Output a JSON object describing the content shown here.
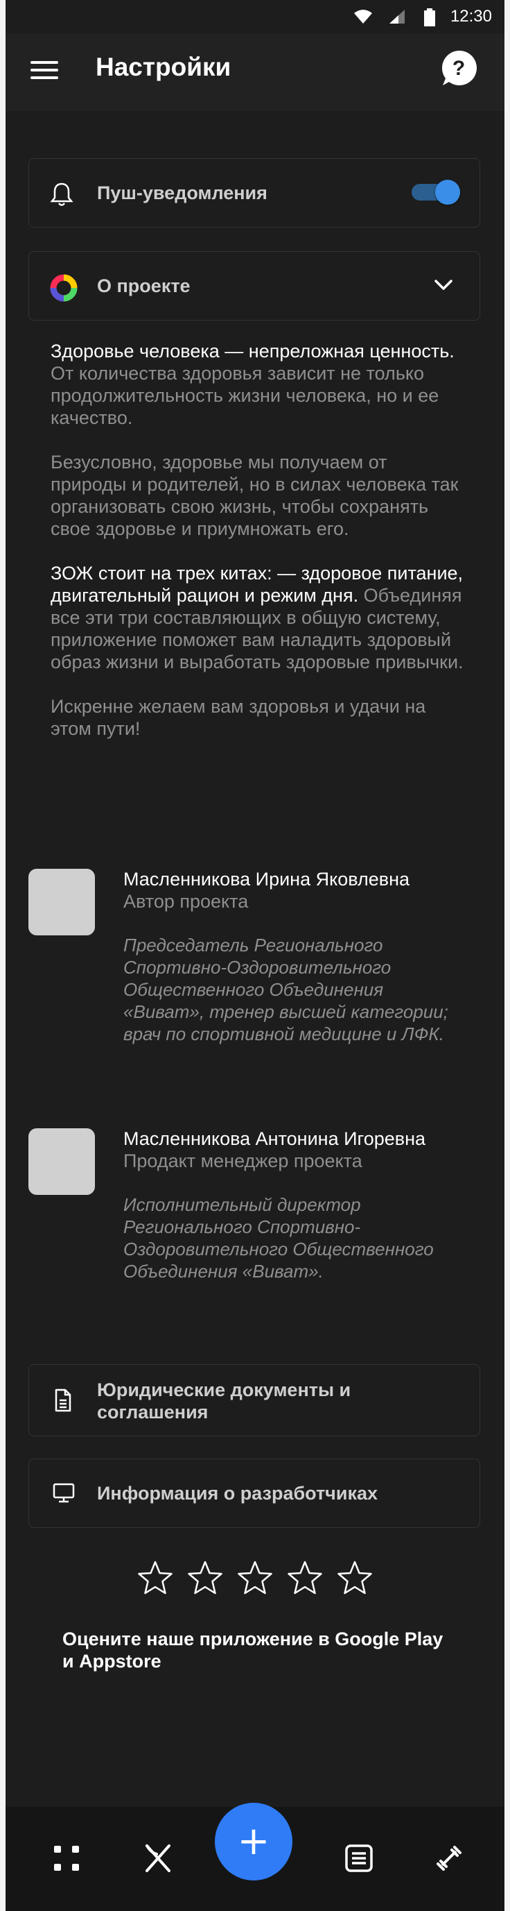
{
  "status_bar": {
    "time": "12:30"
  },
  "header": {
    "title": "Настройки"
  },
  "settings": {
    "push_label": "Пуш-уведомления",
    "push_enabled": true,
    "about_label": "О проекте"
  },
  "about": {
    "p1_strong": "Здоровье человека — непреложная ценность.",
    "p1_rest": " От количества здоровья зависит не только продолжительность жизни человека, но и ее качество.",
    "p2": "Безусловно, здоровье мы получаем от природы и родителей, но в силах человека  так организовать свою жизнь, чтобы сохранять свое здоровье и приумножать его.",
    "p3_strong": "ЗОЖ стоит на трех китах:  — здоровое питание, двигательный рацион и режим дня.",
    "p3_rest": " Объединяя все эти три составляющих в общую систему, приложение поможет вам наладить здоровый образ жизни и выработать здоровые привычки.",
    "p4": "Искренне желаем вам здоровья и удачи на этом пути!"
  },
  "team": [
    {
      "name": "Масленникова Ирина Яковлевна",
      "role": "Автор проекта",
      "description": "Председатель Регионального Спортивно-Оздоровительного Общественного Объединения «Виват», тренер высшей категории; врач по спортивной медицине и ЛФК."
    },
    {
      "name": "Масленникова Антонина Игоревна",
      "role": "Продакт менеджер проекта",
      "description": "Исполнительный директор Регионального Спортивно-Оздоровительного Общественного Объединения «Виват»."
    }
  ],
  "links": {
    "legal_docs": "Юридические документы и соглашения",
    "developers_info": "Информация о разработчиках"
  },
  "rating": {
    "stars_total": 5,
    "stars_filled": 0,
    "prompt": "Оцените наше приложение в Google Play и Appstore"
  },
  "bottom_nav": {
    "items": [
      "grid-icon",
      "fork-knife-icon",
      "add-icon",
      "notes-icon",
      "dumbbell-icon"
    ],
    "fab_symbol": "+"
  },
  "colors": {
    "background": "#1d1d1d",
    "accent": "#2f7cf6",
    "toggle_on": "#3a8ee8",
    "text_primary": "#ffffff",
    "text_secondary": "#8f8f8f"
  }
}
